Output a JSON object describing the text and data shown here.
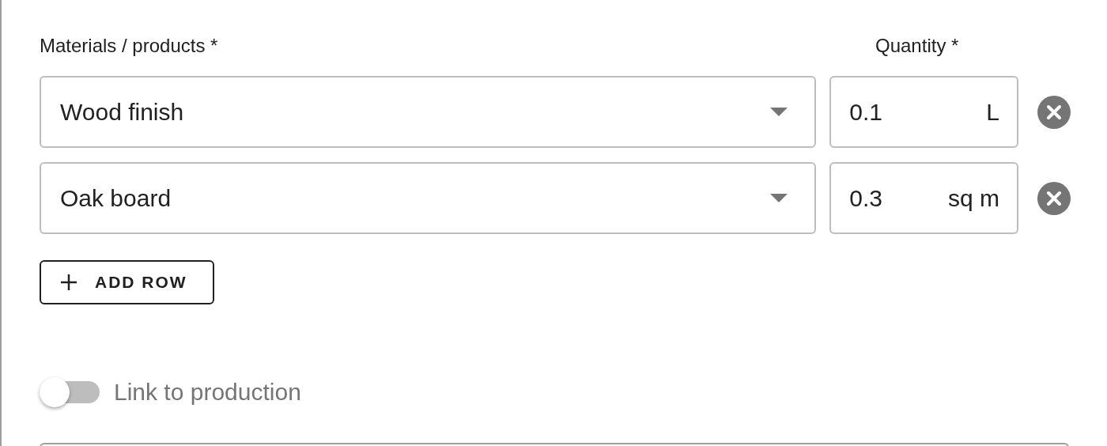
{
  "materials_label": "Materials / products *",
  "quantity_label": "Quantity *",
  "rows": [
    {
      "material": "Wood finish",
      "quantity": "0.1",
      "unit": "L"
    },
    {
      "material": "Oak board",
      "quantity": "0.3",
      "unit": "sq m"
    }
  ],
  "add_button": {
    "label": "ADD ROW"
  },
  "link_toggle": {
    "label": "Link to production",
    "on": false
  }
}
